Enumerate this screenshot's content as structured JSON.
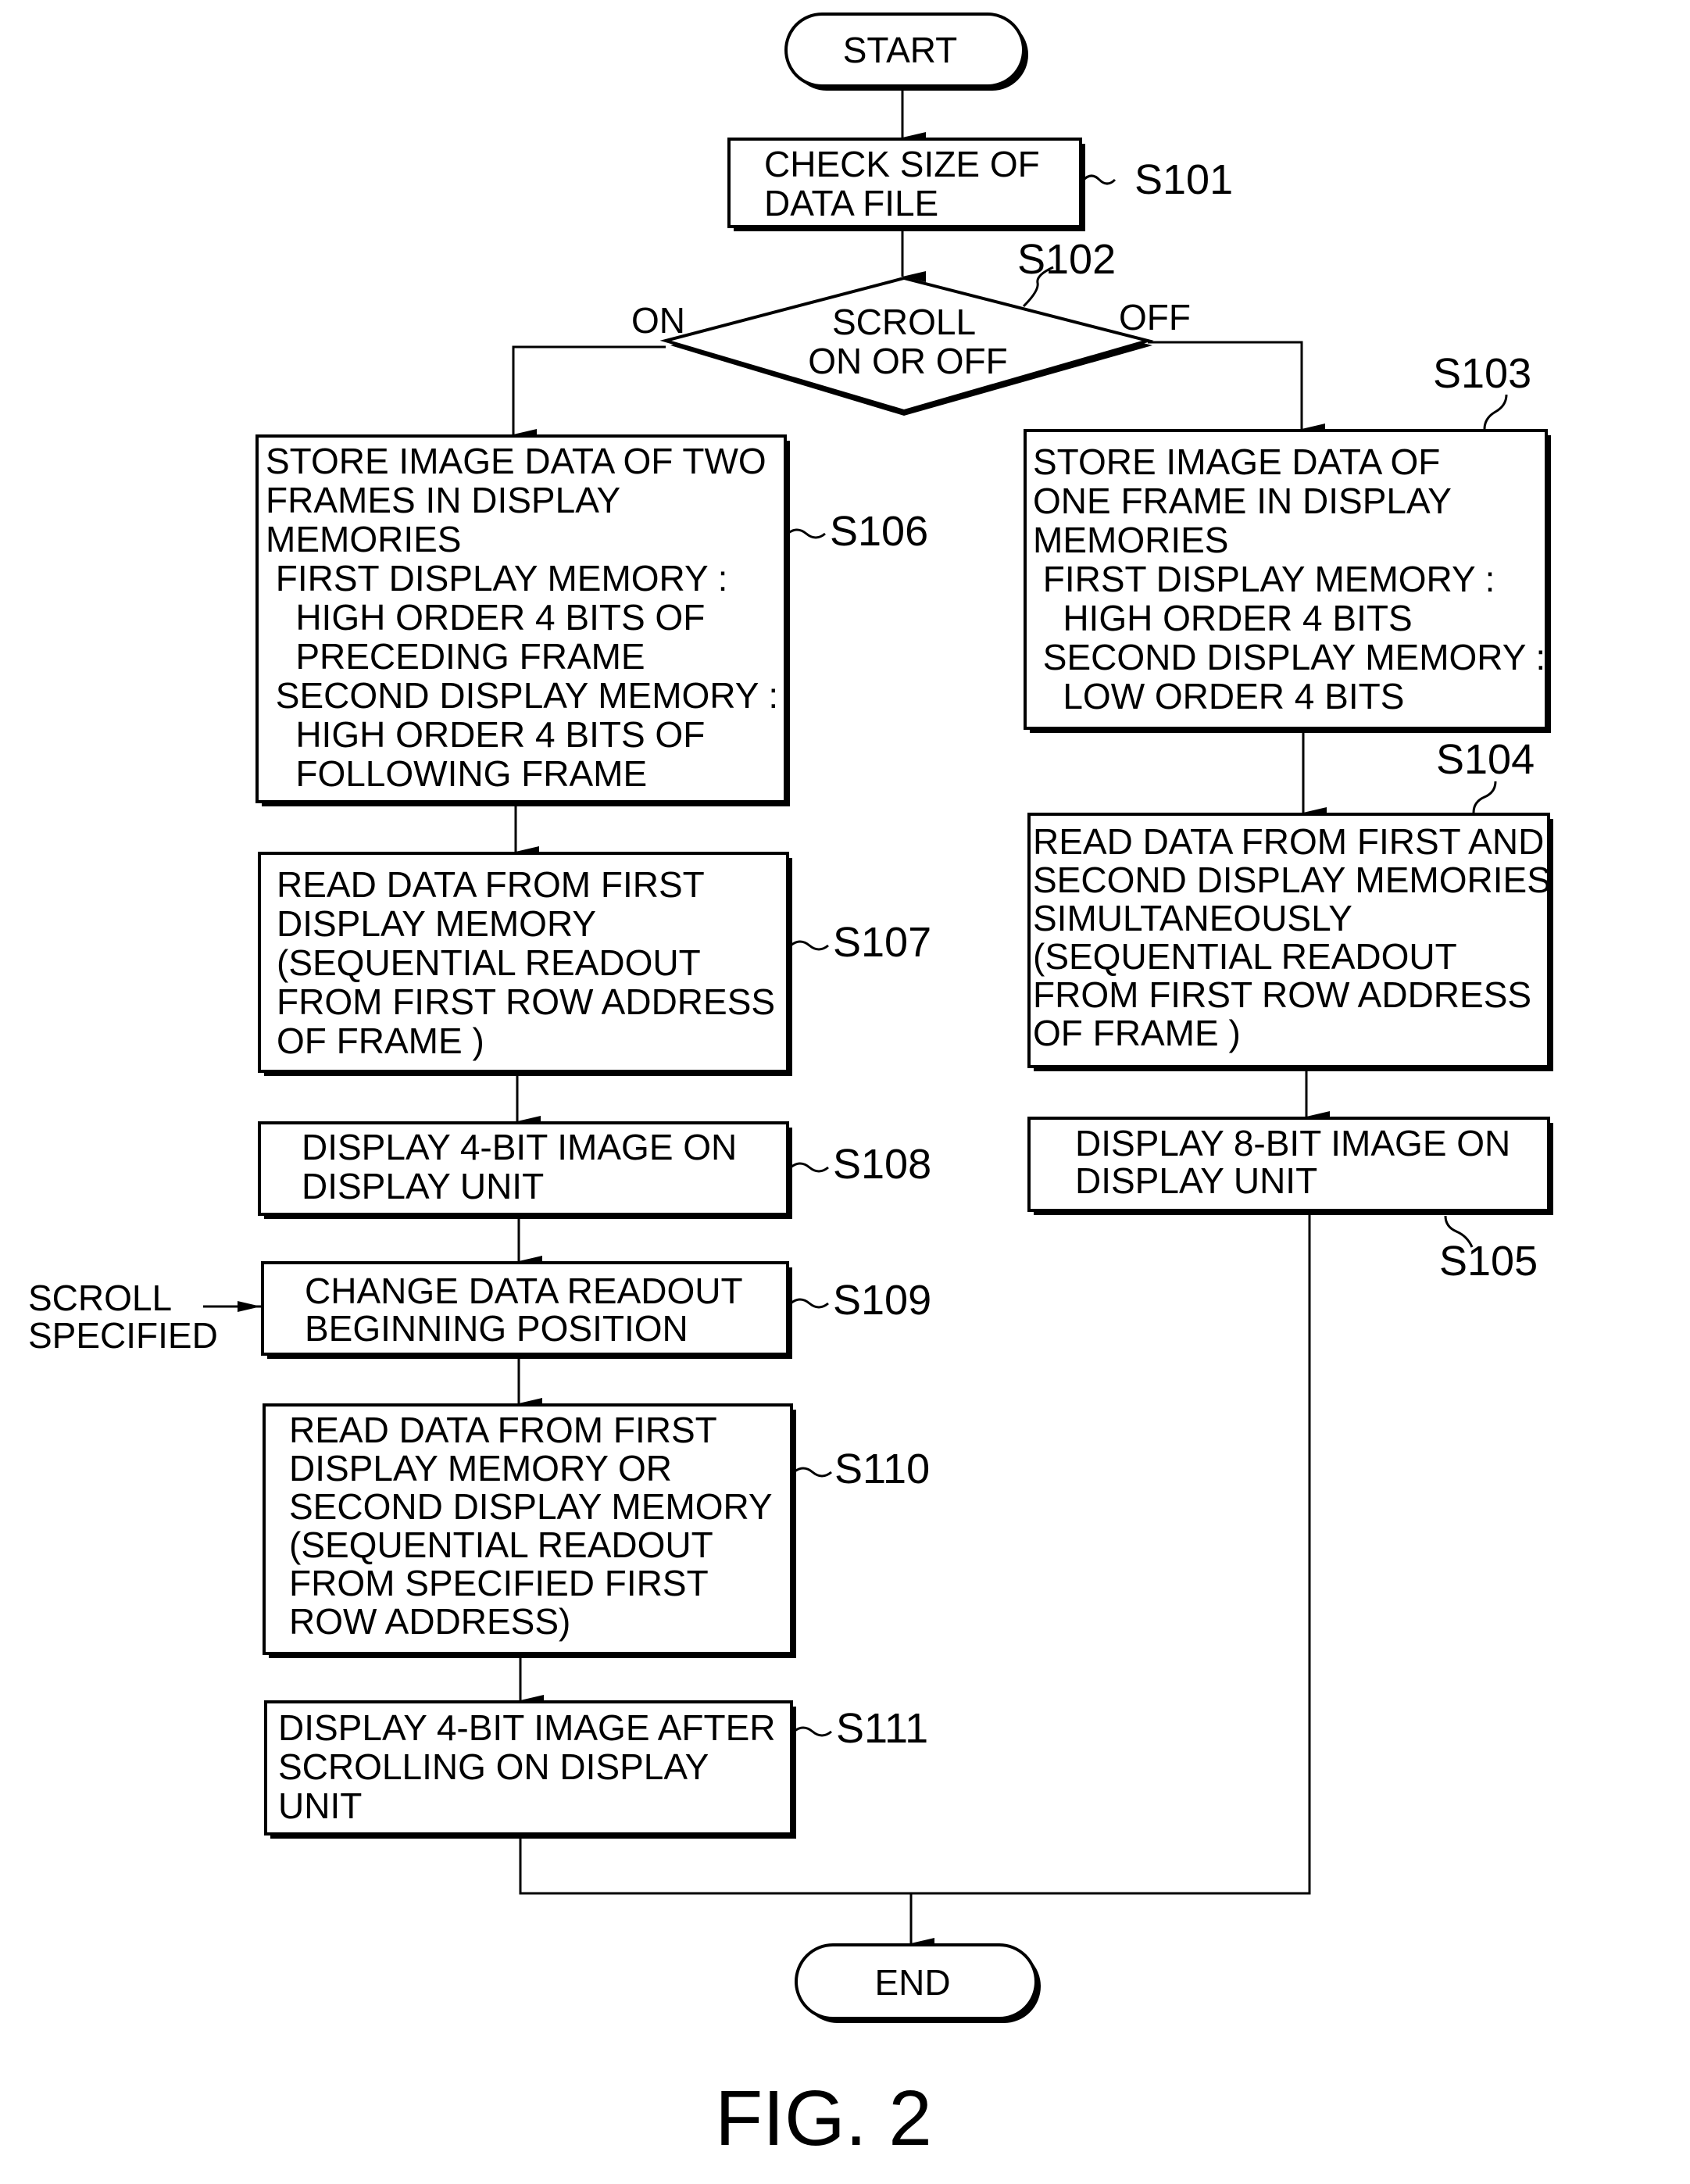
{
  "figure": {
    "title": "FIG. 2",
    "start_label": "START",
    "end_label": "END"
  },
  "steps": {
    "s101": {
      "id": "S101",
      "lines": [
        "CHECK SIZE OF",
        "DATA FILE"
      ]
    },
    "s102": {
      "id": "S102",
      "lines": [
        "SCROLL",
        "ON OR OFF"
      ],
      "yes_label": "ON",
      "no_label": "OFF"
    },
    "s103": {
      "id": "S103",
      "lines": [
        "STORE IMAGE DATA OF",
        "ONE FRAME IN DISPLAY",
        "MEMORIES",
        " FIRST DISPLAY MEMORY :",
        "   HIGH ORDER 4 BITS",
        " SECOND DISPLAY MEMORY :",
        "   LOW ORDER 4 BITS"
      ]
    },
    "s104": {
      "id": "S104",
      "lines": [
        "READ DATA FROM FIRST AND",
        "SECOND DISPLAY MEMORIES",
        "SIMULTANEOUSLY",
        "(SEQUENTIAL READOUT",
        "FROM FIRST ROW ADDRESS",
        "OF FRAME )"
      ]
    },
    "s105": {
      "id": "S105",
      "lines": [
        "DISPLAY 8-BIT IMAGE ON",
        "DISPLAY UNIT"
      ]
    },
    "s106": {
      "id": "S106",
      "lines": [
        "STORE IMAGE DATA OF TWO",
        "FRAMES IN DISPLAY",
        "MEMORIES",
        " FIRST DISPLAY MEMORY :",
        "   HIGH ORDER 4 BITS OF",
        "   PRECEDING FRAME",
        " SECOND DISPLAY MEMORY :",
        "   HIGH ORDER 4 BITS OF",
        "   FOLLOWING FRAME"
      ]
    },
    "s107": {
      "id": "S107",
      "lines": [
        "READ DATA FROM FIRST",
        "DISPLAY MEMORY",
        "(SEQUENTIAL READOUT",
        "FROM FIRST ROW ADDRESS",
        "OF FRAME )"
      ]
    },
    "s108": {
      "id": "S108",
      "lines": [
        "DISPLAY 4-BIT IMAGE ON",
        "DISPLAY UNIT"
      ]
    },
    "s109": {
      "id": "S109",
      "lines": [
        "CHANGE DATA READOUT",
        "BEGINNING POSITION"
      ],
      "input_lines": [
        "SCROLL",
        "SPECIFIED"
      ]
    },
    "s110": {
      "id": "S110",
      "lines": [
        "READ DATA FROM FIRST",
        "DISPLAY MEMORY OR",
        "SECOND DISPLAY MEMORY",
        "(SEQUENTIAL READOUT",
        "FROM SPECIFIED FIRST",
        "ROW ADDRESS)"
      ]
    },
    "s111": {
      "id": "S111",
      "lines": [
        "DISPLAY 4-BIT IMAGE AFTER",
        "SCROLLING ON DISPLAY",
        "UNIT"
      ]
    }
  }
}
